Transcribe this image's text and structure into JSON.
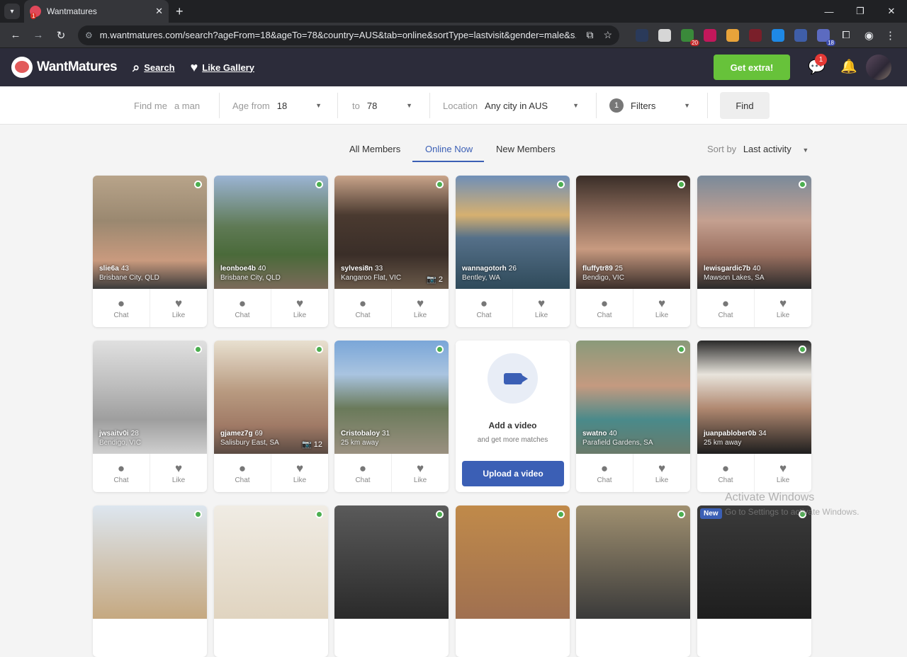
{
  "browser": {
    "tab_title": "Wantmatures",
    "url": "m.wantmatures.com/search?ageFrom=18&ageTo=78&country=AUS&tab=online&sortType=lastvisit&gender=male&s...",
    "ext_badge_1": "20",
    "ext_badge_2": "18"
  },
  "header": {
    "logo_text": "WantMatures",
    "nav_search": "Search",
    "nav_like_gallery": "Like Gallery",
    "get_extra": "Get extra!",
    "message_badge": "1"
  },
  "filters": {
    "find_me_label": "Find me",
    "find_me_value": "a man",
    "age_from_label": "Age from",
    "age_from_value": "18",
    "age_to_label": "to",
    "age_to_value": "78",
    "location_label": "Location",
    "location_value": "Any city in AUS",
    "filters_count": "1",
    "filters_label": "Filters",
    "find_button": "Find"
  },
  "tabs": {
    "all_members": "All Members",
    "online_now": "Online Now",
    "new_members": "New Members",
    "sort_by_label": "Sort by",
    "sort_by_value": "Last activity"
  },
  "actions": {
    "chat": "Chat",
    "like": "Like"
  },
  "members": [
    {
      "name": "slie6a",
      "age": "43",
      "location": "Brisbane City, QLD",
      "photos": "",
      "bg": "linear-gradient(180deg,#b8a48a 0%,#9a8870 40%,#c99a7e 75%,#3a3a3a 100%)"
    },
    {
      "name": "leonboe4b",
      "age": "40",
      "location": "Brisbane City, QLD",
      "photos": "",
      "bg": "linear-gradient(180deg,#9bb4d4 0%,#5f7a55 45%,#4a6a3a 70%,#7a6a5a 100%)"
    },
    {
      "name": "sylvesi8n",
      "age": "33",
      "location": "Kangaroo Flat, VIC",
      "photos": "2",
      "bg": "linear-gradient(180deg,#c9a48a 0%,#4a3a30 35%,#3a2e28 70%,#6a5a4a 100%)"
    },
    {
      "name": "wannagotorh",
      "age": "26",
      "location": "Bentley, WA",
      "photos": "",
      "bg": "linear-gradient(180deg,#6f8fb8 0%,#d6b070 35%,#557089 55%,#2f4a5a 100%)"
    },
    {
      "name": "fluffytr89",
      "age": "25",
      "location": "Bendigo, VIC",
      "photos": "",
      "bg": "linear-gradient(180deg,#3a2e28 0%,#8a6a5a 35%,#c89a80 65%,#3a2e2a 100%)"
    },
    {
      "name": "lewisgardic7b",
      "age": "40",
      "location": "Mawson Lakes, SA",
      "photos": "",
      "bg": "linear-gradient(180deg,#7a8a9a 0%,#c4a090 40%,#9a7060 70%,#2a2a2a 100%)"
    },
    {
      "name": "jwsaitv0i",
      "age": "28",
      "location": "Bendigo, VIC",
      "photos": "",
      "bg": "linear-gradient(180deg,#e0e0e0 0%,#bdbdbd 40%,#9e9e9e 70%,#cfcfcf 100%)"
    },
    {
      "name": "gjamez7g",
      "age": "69",
      "location": "Salisbury East, SA",
      "photos": "12",
      "bg": "linear-gradient(180deg,#e8e0d0 0%,#b89a80 45%,#a07a66 75%,#5a4a42 100%)"
    },
    {
      "name": "Cristobaloy",
      "age": "31",
      "location": "25 km away",
      "photos": "",
      "bg": "linear-gradient(180deg,#7aa6d8 0%,#a9c4e0 30%,#6a7a5a 60%,#9a9080 100%)"
    },
    {
      "type": "video",
      "title": "Add a video",
      "subtitle": "and get more matches",
      "button": "Upload a video"
    },
    {
      "name": "swatno",
      "age": "40",
      "location": "Parafield Gardens, SA",
      "photos": "",
      "bg": "linear-gradient(180deg,#8a9a7a 0%,#c49a80 40%,#4a8a8a 70%,#6a7a6a 100%)"
    },
    {
      "name": "juanpablober0b",
      "age": "34",
      "location": "25 km away",
      "photos": "",
      "bg": "linear-gradient(180deg,#2a2a2a 0%,#e8e4dc 30%,#b08870 60%,#1e1e1e 100%)"
    }
  ],
  "partial_row": [
    {
      "bg": "linear-gradient(180deg,#dde6ef,#c5a880)",
      "new": ""
    },
    {
      "bg": "linear-gradient(180deg,#f0ece4,#e0d4c0)",
      "new": ""
    },
    {
      "bg": "linear-gradient(180deg,#5a5a5a,#2a2a2a)",
      "new": ""
    },
    {
      "bg": "linear-gradient(180deg,#c08a4a,#a07050)",
      "new": ""
    },
    {
      "bg": "linear-gradient(180deg,#a09070,#3a3a3a)",
      "new": ""
    },
    {
      "bg": "linear-gradient(180deg,#3a3a3a,#1e1e1e)",
      "new": "New"
    }
  ],
  "os": {
    "watermark_title": "Activate Windows",
    "watermark_sub": "Go to Settings to activate Windows."
  }
}
